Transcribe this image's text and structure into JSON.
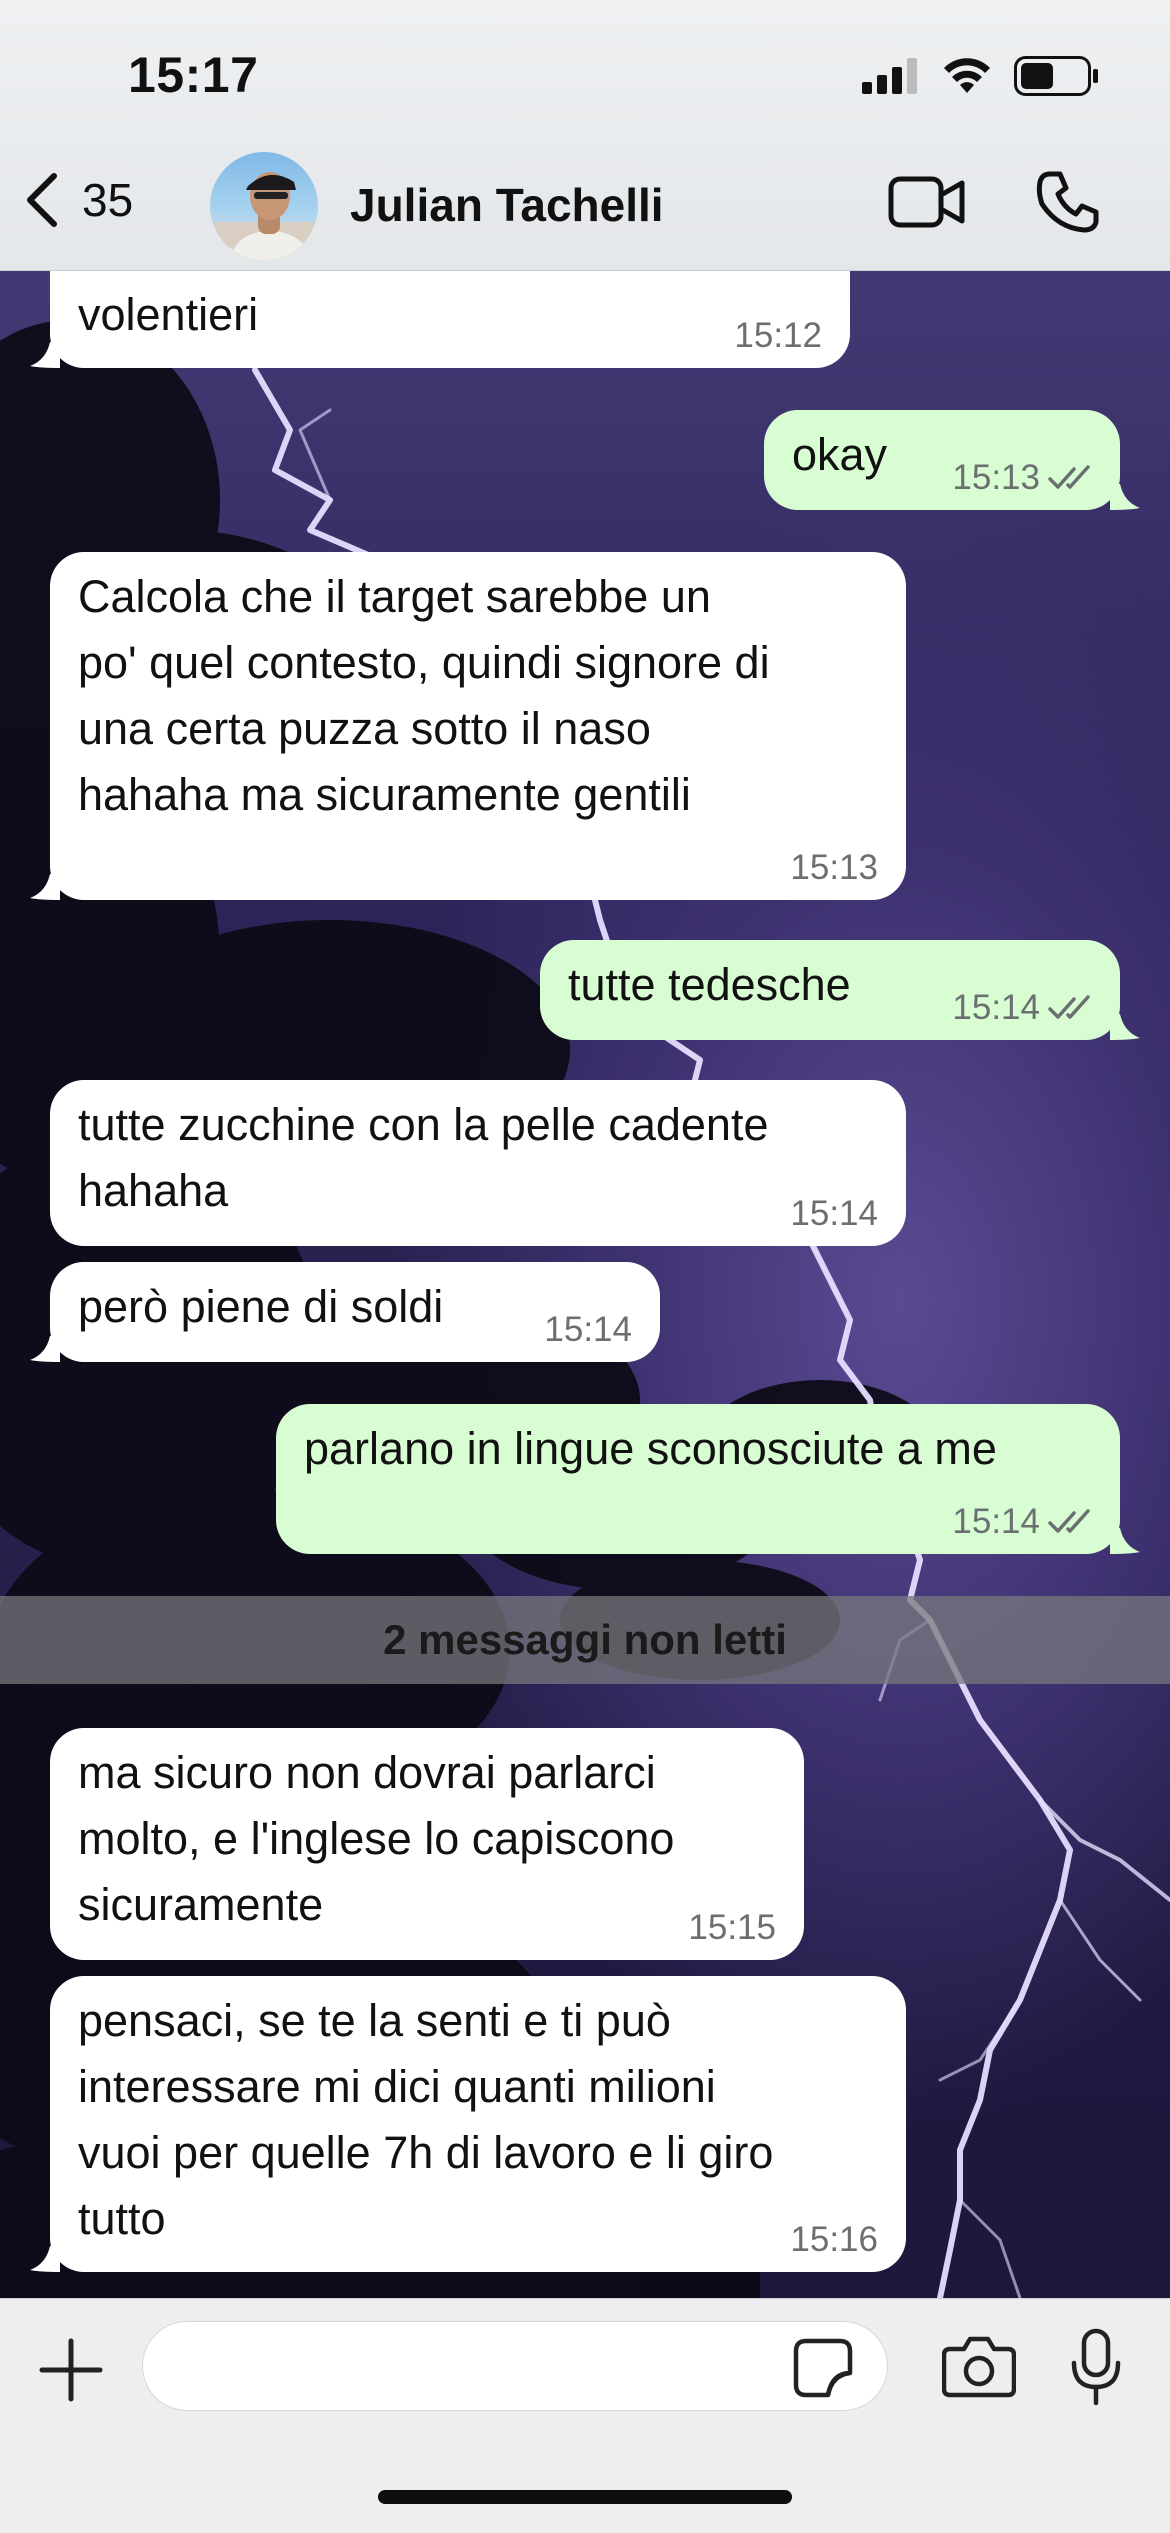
{
  "status_bar": {
    "time": "15:17"
  },
  "nav": {
    "back_count": "35",
    "contact_name": "Julian Tachelli"
  },
  "messages": [
    {
      "direction": "in",
      "text": "volentieri",
      "time": "15:12"
    },
    {
      "direction": "out",
      "text": "okay",
      "time": "15:13",
      "read": true
    },
    {
      "direction": "in",
      "text": "Calcola che il target sarebbe un\npo' quel contesto, quindi signore di\nuna certa puzza sotto il naso\nhahaha ma sicuramente gentili",
      "time": "15:13"
    },
    {
      "direction": "out",
      "text": "tutte tedesche",
      "time": "15:14",
      "read": true
    },
    {
      "direction": "in",
      "text": "tutte zucchine con la pelle cadente\nhahaha",
      "time": "15:14"
    },
    {
      "direction": "in",
      "text": "però piene di soldi",
      "time": "15:14"
    },
    {
      "direction": "out",
      "text": "parlano in lingue sconosciute a me",
      "time": "15:14",
      "read": true
    },
    {
      "direction": "in",
      "text": "ma sicuro non dovrai parlarci\nmolto, e l'inglese lo capiscono\nsicuramente",
      "time": "15:15"
    },
    {
      "direction": "in",
      "text": "pensaci, se te la senti e ti può\ninteressare mi dici quanti milioni\nvuoi per quelle 7h di lavoro e li giro\ntutto",
      "time": "15:16"
    }
  ],
  "unread_banner": "2 messaggi non letti",
  "composer": {
    "value": "",
    "placeholder": ""
  },
  "icons": {
    "back": "chevron-left-icon",
    "video": "video-camera-icon",
    "call": "phone-icon",
    "add": "plus-icon",
    "sticker": "sticker-icon",
    "camera": "camera-icon",
    "mic": "microphone-icon",
    "read_receipt": "double-check-icon"
  },
  "colors": {
    "incoming_bubble": "#ffffff",
    "outgoing_bubble": "#d9fdd3",
    "header_bg": "#e9ebee",
    "read_check": "#6b6f72"
  }
}
